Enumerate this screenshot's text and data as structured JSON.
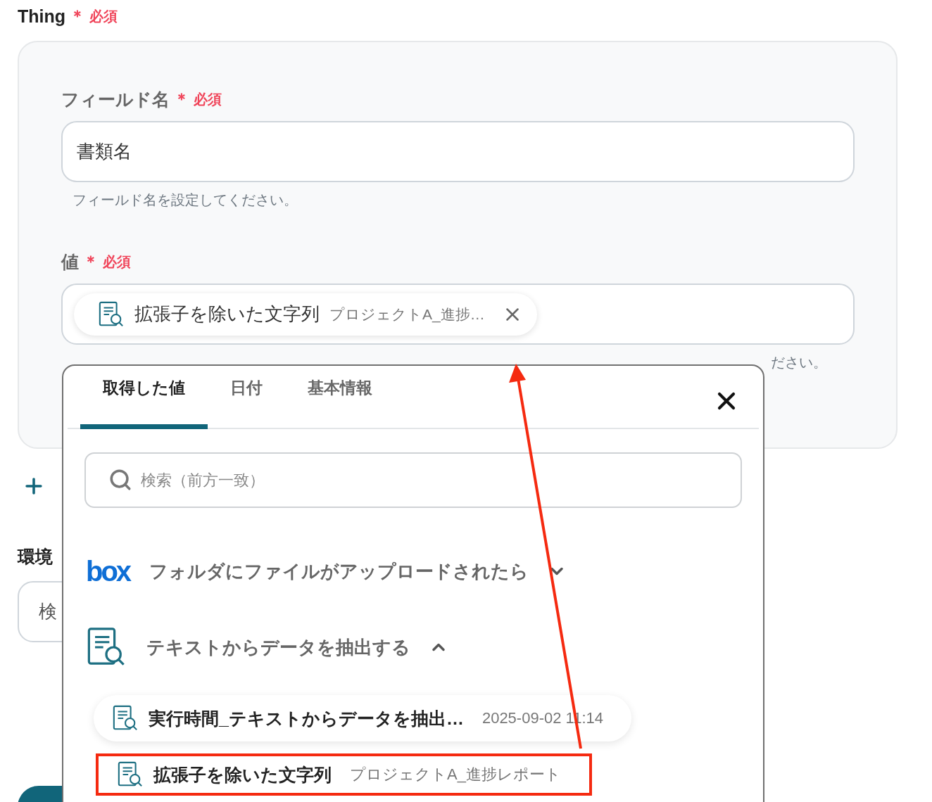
{
  "title": {
    "label": "Thing",
    "asterisk": "＊",
    "required": "必須"
  },
  "card": {
    "fields": [
      {
        "kind": "text",
        "label": "フィールド名",
        "asterisk": "＊",
        "required": "必須",
        "value": "書類名",
        "hint": "フィールド名を設定してください。"
      },
      {
        "kind": "chips",
        "label": "値",
        "asterisk": "＊",
        "required": "必須",
        "chip": {
          "name": "拡張子を除いた文字列",
          "value": "プロジェクトA_進捗…"
        },
        "hint": "ださい。"
      }
    ]
  },
  "environment": {
    "label": "環境",
    "field_text": "検"
  },
  "popup": {
    "tabs": [
      {
        "label": "取得した値",
        "selected": true
      },
      {
        "label": "日付",
        "selected": false
      },
      {
        "label": "基本情報",
        "selected": false
      }
    ],
    "search": {
      "placeholder": "検索（前方一致）"
    },
    "groups": [
      {
        "kind": "box",
        "logo": "box",
        "title": "フォルダにファイルがアップロードされたら",
        "expanded": false
      },
      {
        "kind": "extract",
        "title": "テキストからデータを抽出する",
        "expanded": true,
        "items": [
          {
            "name": "実行時間_テキストからデータを抽出…",
            "value": "2025-09-02 11:14",
            "highlighted": false
          },
          {
            "name": "拡張子を除いた文字列",
            "value": "プロジェクトA_進捗レポート",
            "highlighted": true
          }
        ]
      }
    ]
  }
}
